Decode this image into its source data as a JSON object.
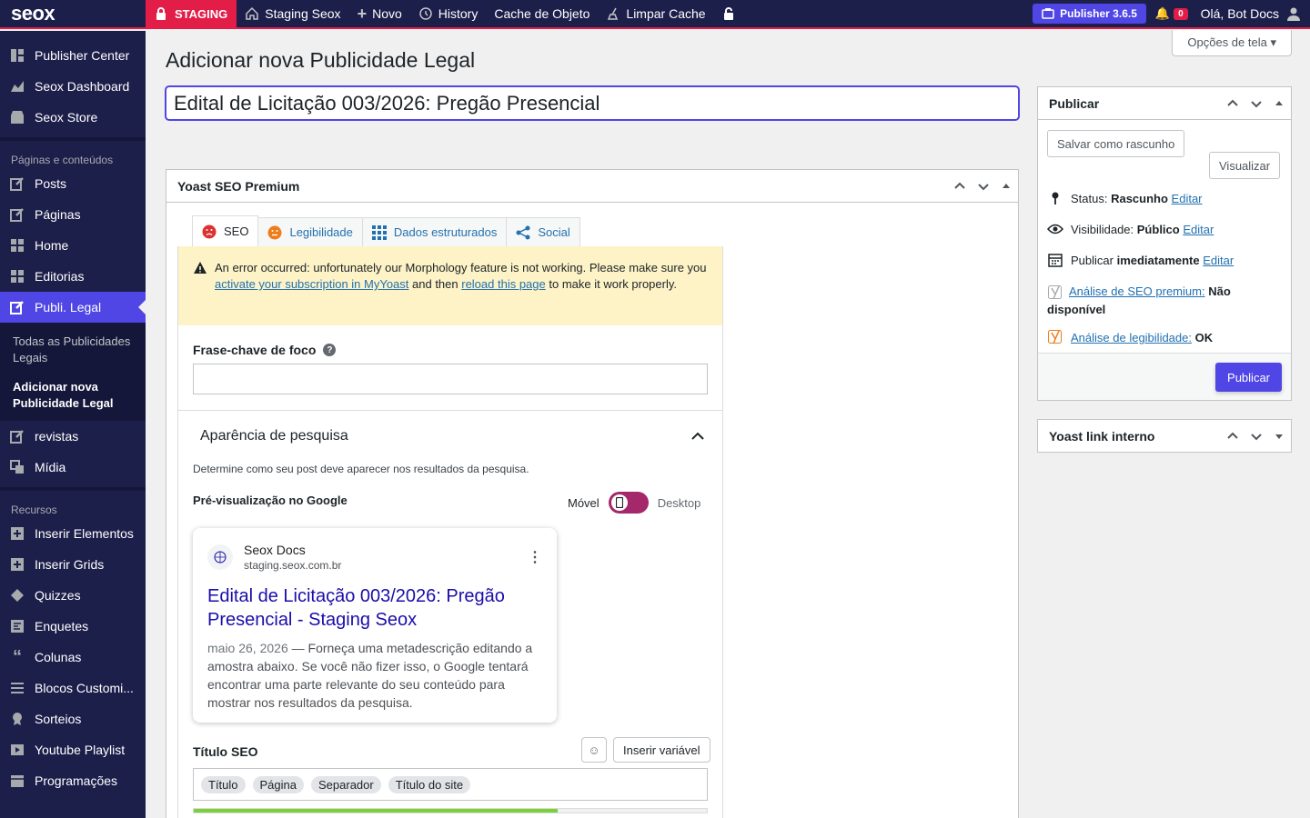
{
  "adminbar": {
    "logo": "seox",
    "staging": "STAGING",
    "site": "Staging Seox",
    "new": "Novo",
    "history": "History",
    "cache_obj": "Cache de Objeto",
    "clear_cache": "Limpar Cache",
    "publisher": "Publisher 3.6.5",
    "notifications": "0",
    "greeting": "Olá, Bot Docs"
  },
  "sidebar": {
    "top_items": [
      {
        "label": "Publisher Center",
        "icon": "grid-icon"
      },
      {
        "label": "Seox Dashboard",
        "icon": "dashboard-icon"
      },
      {
        "label": "Seox Store",
        "icon": "store-icon"
      }
    ],
    "heading1": "Páginas e conteúdos",
    "content_items": [
      {
        "label": "Posts",
        "icon": "edit-icon"
      },
      {
        "label": "Páginas",
        "icon": "edit-icon"
      },
      {
        "label": "Home",
        "icon": "blocks-icon"
      },
      {
        "label": "Editorias",
        "icon": "blocks-icon"
      },
      {
        "label": "Publi. Legal",
        "icon": "edit-icon"
      }
    ],
    "submenu": [
      "Todas as Publicidades Legais",
      "Adicionar nova Publicidade Legal"
    ],
    "after_items": [
      {
        "label": "revistas",
        "icon": "edit-icon"
      },
      {
        "label": "Mídia",
        "icon": "media-icon"
      }
    ],
    "heading2": "Recursos",
    "resource_items": [
      {
        "label": "Inserir Elementos",
        "icon": "plus-box-icon"
      },
      {
        "label": "Inserir Grids",
        "icon": "plus-box-icon"
      },
      {
        "label": "Quizzes",
        "icon": "tag-icon"
      },
      {
        "label": "Enquetes",
        "icon": "poll-icon"
      },
      {
        "label": "Colunas",
        "icon": "quote-icon"
      },
      {
        "label": "Blocos Customi...",
        "icon": "list-icon"
      },
      {
        "label": "Sorteios",
        "icon": "award-icon"
      },
      {
        "label": "Youtube Playlist",
        "icon": "video-icon"
      },
      {
        "label": "Programações",
        "icon": "calendar-icon"
      }
    ]
  },
  "screen_options": "Opções de tela",
  "page_title": "Adicionar nova Publicidade Legal",
  "post_title": "Edital de Licitação 003/2026: Pregão Presencial",
  "yoast": {
    "box_title": "Yoast SEO Premium",
    "tabs": [
      "SEO",
      "Legibilidade",
      "Dados estruturados",
      "Social"
    ],
    "alert_pre": "An error occurred: unfortunately our Morphology feature is not working. Please make sure you ",
    "alert_link1": "activate your subscription in MyYoast",
    "alert_mid": " and then ",
    "alert_link2": "reload this page",
    "alert_post": " to make it work properly.",
    "focus_label": "Frase-chave de foco",
    "appearance_title": "Aparência de pesquisa",
    "appearance_desc": "Determine como seu post deve aparecer nos resultados da pesquisa.",
    "gpreview_label": "Pré-visualização no Google",
    "mobile": "Móvel",
    "desktop": "Desktop",
    "card": {
      "site_name": "Seox Docs",
      "site_url": "staging.seox.com.br",
      "title": "Edital de Licitação 003/2026: Pregão Presencial - Staging Seox",
      "date": "maio 26, 2026",
      "dash": " — ",
      "desc": "Forneça uma metadescrição editando a amostra abaixo. Se você não fizer isso, o Google tentará encontrar uma parte relevante do seu conteúdo para mostrar nos resultados da pesquisa."
    },
    "seo_title_label": "Título SEO",
    "insert_variable": "Inserir variável",
    "pills": [
      "Título",
      "Página",
      "Separador",
      "Título do site"
    ],
    "title_progress": 0.71
  },
  "publish": {
    "title": "Publicar",
    "save_draft": "Salvar como rascunho",
    "preview": "Visualizar",
    "status_label": "Status: ",
    "status_value": "Rascunho",
    "visibility_label": "Visibilidade: ",
    "visibility_value": "Público",
    "publish_label": "Publicar ",
    "publish_value": "imediatamente",
    "edit": "Editar",
    "seo_analysis": "Análise de SEO premium:",
    "seo_value": "Não disponível",
    "readability": "Análise de legibilidade:",
    "readability_value": "OK",
    "publish_button": "Publicar"
  },
  "link_box_title": "Yoast link interno",
  "colors": {
    "brand_dark": "#1d1f4b",
    "accent": "#4f46e5",
    "staging": "#e11d48",
    "alert_bg": "#fef3c7",
    "toggle": "#a4286a"
  }
}
